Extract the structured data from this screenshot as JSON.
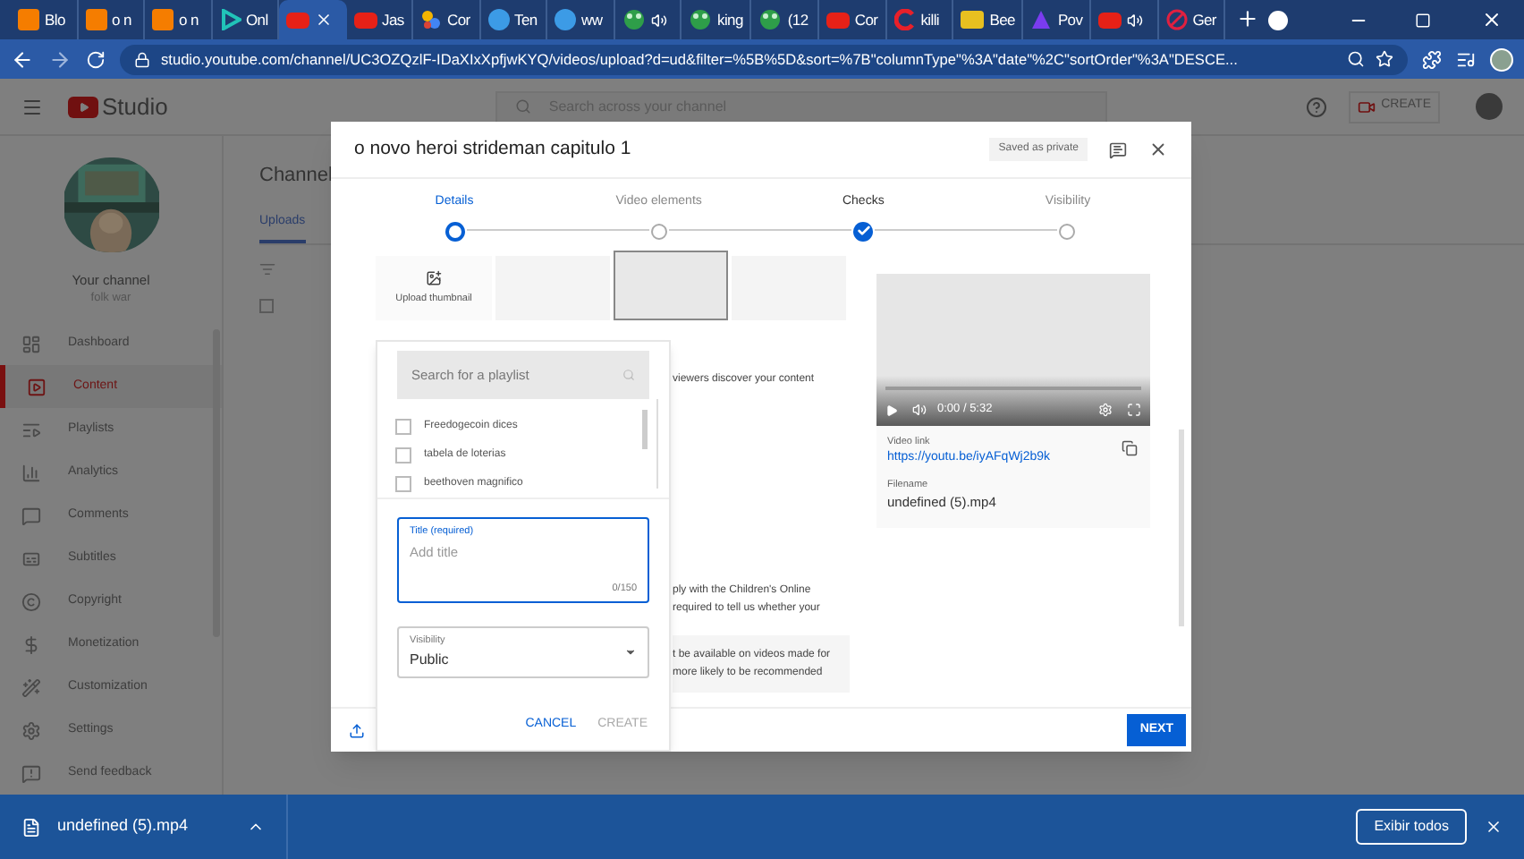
{
  "browser": {
    "tabs": [
      {
        "label": "Blo",
        "kind": "blogger",
        "selected": false,
        "audio": false
      },
      {
        "label": "o n",
        "kind": "blogger",
        "selected": false,
        "audio": false
      },
      {
        "label": "o n",
        "kind": "blogger",
        "selected": false,
        "audio": false
      },
      {
        "label": "Onl",
        "kind": "play",
        "selected": false,
        "audio": false
      },
      {
        "kind": "youtube",
        "selected": true,
        "audio": false
      },
      {
        "label": "Jas",
        "kind": "youtube",
        "selected": false,
        "audio": false
      },
      {
        "label": "Cor",
        "kind": "dots",
        "selected": false,
        "audio": false
      },
      {
        "label": "Ten",
        "kind": "letter",
        "selected": false,
        "audio": false
      },
      {
        "label": "ww",
        "kind": "letter",
        "selected": false,
        "audio": false
      },
      {
        "kind": "frog",
        "selected": false,
        "audio": true
      },
      {
        "label": "king",
        "kind": "frog",
        "selected": false,
        "audio": false
      },
      {
        "label": "(12",
        "kind": "frog",
        "selected": false,
        "audio": false
      },
      {
        "label": "Cor",
        "kind": "youtube",
        "selected": false,
        "audio": false
      },
      {
        "label": "killi",
        "kind": "swirl",
        "selected": false,
        "audio": false
      },
      {
        "label": "Bee",
        "kind": "bee",
        "selected": false,
        "audio": false
      },
      {
        "label": "Pov",
        "kind": "pov",
        "selected": false,
        "audio": false
      },
      {
        "kind": "youtube",
        "selected": false,
        "audio": true
      },
      {
        "label": "Ger",
        "kind": "blocked",
        "selected": false,
        "audio": false
      }
    ],
    "url": "studio.youtube.com/channel/UC3OZQzlF-IDaXIxXpfjwKYQ/videos/upload?d=ud&filter=%5B%5D&sort=%7B\"columnType\"%3A\"date\"%2C\"sortOrder\"%3A\"DESCE..."
  },
  "studio": {
    "logo": "Studio",
    "search": {
      "placeholder": "Search across your channel"
    },
    "create": "CREATE",
    "channel": {
      "title": "Your channel",
      "name": "folk war"
    },
    "nav": [
      {
        "label": "Dashboard",
        "selected": false
      },
      {
        "label": "Content",
        "selected": true
      },
      {
        "label": "Playlists",
        "selected": false
      },
      {
        "label": "Analytics",
        "selected": false
      },
      {
        "label": "Comments",
        "selected": false
      },
      {
        "label": "Subtitles",
        "selected": false
      },
      {
        "label": "Copyright",
        "selected": false
      },
      {
        "label": "Monetization",
        "selected": false
      },
      {
        "label": "Customization",
        "selected": false
      },
      {
        "label": "Settings",
        "selected": false
      },
      {
        "label": "Send feedback",
        "selected": false
      }
    ],
    "page_title": "Channel",
    "tabs": [
      {
        "label": "Uploads",
        "selected": true
      }
    ],
    "select_all": {
      "checked": false
    }
  },
  "dialog": {
    "title": "o novo heroi strideman capitulo 1",
    "status": "Saved as private",
    "steps": [
      {
        "label": "Details",
        "selected": true,
        "done": false
      },
      {
        "label": "Video elements",
        "selected": false,
        "done": false
      },
      {
        "label": "Checks",
        "selected": false,
        "done": true
      },
      {
        "label": "Visibility",
        "selected": false,
        "done": false
      }
    ],
    "thumbnails": {
      "upload_label": "Upload thumbnail",
      "slots": [
        {
          "selected": false
        },
        {
          "selected": true
        },
        {
          "selected": false
        }
      ]
    },
    "partial_texts": [
      {
        "kind": "plain",
        "lines": [
          "viewers discover your content"
        ]
      },
      {
        "kind": "plain",
        "lines": [
          "ply with the Children's Online",
          "required to tell us whether your"
        ]
      },
      {
        "kind": "notice",
        "lines": [
          "t be available on videos made for",
          "more likely to be recommended"
        ]
      }
    ],
    "playlist_menu": {
      "search": {
        "placeholder": "Search for a playlist"
      },
      "playlists": [
        {
          "name": "Freedogecoin dices",
          "checked": false
        },
        {
          "name": "tabela de loterias",
          "checked": false
        },
        {
          "name": "beethoven magnifico",
          "checked": false
        }
      ],
      "title_field": {
        "label": "Title (required)",
        "placeholder": "Add title",
        "counter": "0/150"
      },
      "visibility": {
        "label": "Visibility",
        "value": "Public"
      },
      "buttons": [
        {
          "label": "CANCEL",
          "disabled": false
        },
        {
          "label": "CREATE",
          "disabled": true
        }
      ]
    },
    "video": {
      "time": "0:00 / 5:32",
      "link_label": "Video link",
      "link": "https://youtu.be/iyAFqWj2b9k",
      "filename_label": "Filename",
      "filename": "undefined (5).mp4"
    },
    "next": "NEXT"
  },
  "downloads": {
    "items": [
      {
        "name": "undefined (5).mp4"
      }
    ],
    "show_all": "Exibir todos"
  }
}
